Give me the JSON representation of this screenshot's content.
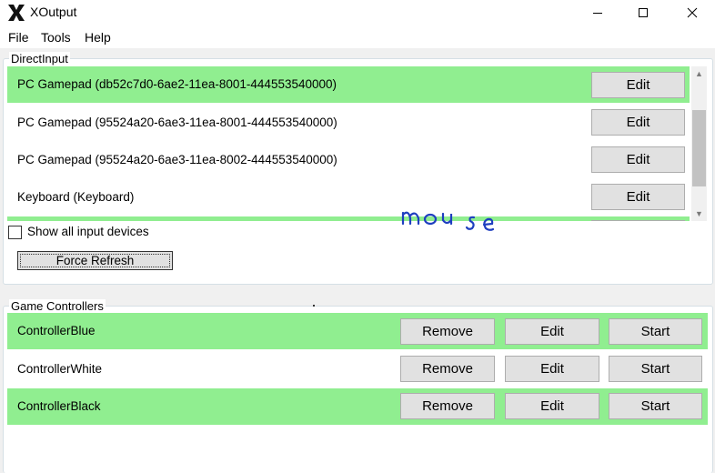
{
  "window": {
    "title": "XOutput"
  },
  "menu": [
    "File",
    "Tools",
    "Help"
  ],
  "direct_input": {
    "label": "DirectInput",
    "devices": [
      {
        "name": "PC Gamepad (db52c7d0-6ae2-11ea-8001-444553540000)",
        "edit_label": "Edit",
        "selected": true
      },
      {
        "name": "PC Gamepad (95524a20-6ae3-11ea-8001-444553540000)",
        "edit_label": "Edit",
        "selected": false
      },
      {
        "name": "PC Gamepad (95524a20-6ae3-11ea-8002-444553540000)",
        "edit_label": "Edit",
        "selected": false
      },
      {
        "name": "Keyboard (Keyboard)",
        "edit_label": "Edit",
        "selected": false
      }
    ],
    "show_all_label": "Show all input devices",
    "show_all_checked": false,
    "refresh_label": "Force Refresh"
  },
  "annotation": {
    "text": "mouse",
    "color": "#1f3fbf"
  },
  "game_controllers": {
    "label": "Game Controllers",
    "controllers": [
      {
        "name": "ControllerBlue",
        "remove_label": "Remove",
        "edit_label": "Edit",
        "start_label": "Start",
        "selected": true
      },
      {
        "name": "ControllerWhite",
        "remove_label": "Remove",
        "edit_label": "Edit",
        "start_label": "Start",
        "selected": false
      },
      {
        "name": "ControllerBlack",
        "remove_label": "Remove",
        "edit_label": "Edit",
        "start_label": "Start",
        "selected": true
      }
    ]
  },
  "colors": {
    "selected_row": "#90ee90",
    "button": "#e1e1e1"
  }
}
